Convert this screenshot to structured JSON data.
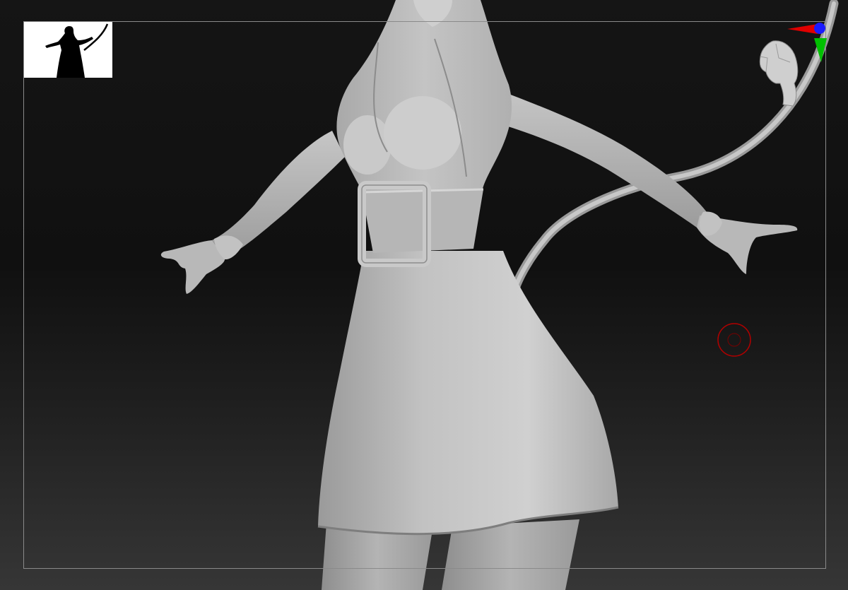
{
  "viewport": {
    "background_top": "#151515",
    "background_bottom": "#363636",
    "frame_color": "#8a8a8a",
    "model_color": "#b9b9b9"
  },
  "thumbnail": {
    "icon": "figure-silhouette-icon",
    "background": "#ffffff",
    "fill": "#000000"
  },
  "navigator": {
    "icon": "head-orientation-icon",
    "axis_colors": {
      "x": "#e00000",
      "y": "#00c000",
      "z": "#1a1aff"
    }
  },
  "brush": {
    "icon": "brush-cursor-icon",
    "color": "#b00000"
  }
}
